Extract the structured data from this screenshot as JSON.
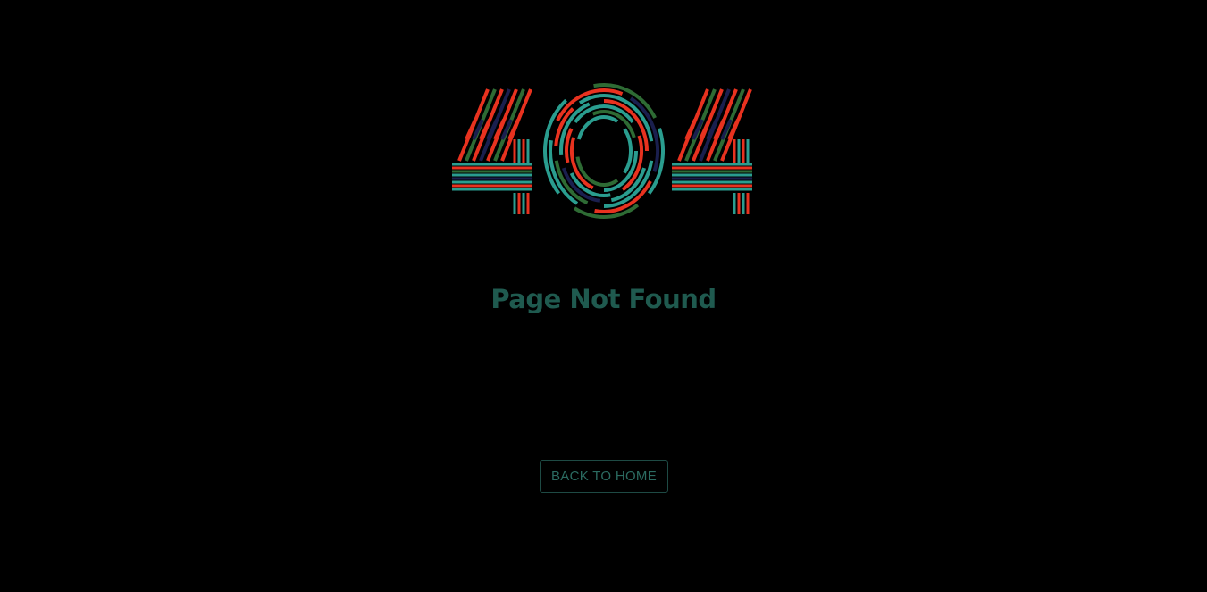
{
  "hero": {
    "graphic_text": "404",
    "colors": {
      "red": "#e8321f",
      "teal": "#2a9d8f",
      "green": "#2e6b34",
      "navy": "#1a1f4e"
    }
  },
  "message": {
    "title": "Page Not Found",
    "color": "#1f5a4f"
  },
  "actions": {
    "back_home_label": "BACK TO HOME",
    "back_home_color": "#2b6b61",
    "back_home_border": "#1e4a44"
  }
}
